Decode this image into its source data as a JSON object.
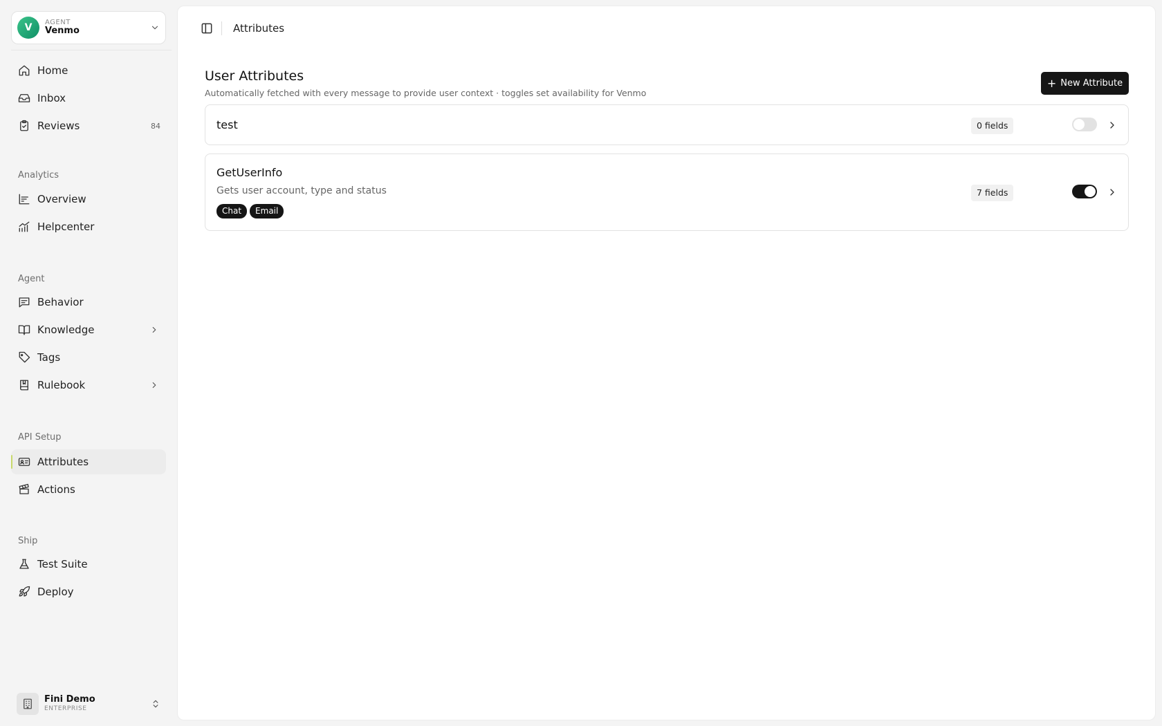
{
  "agent_switcher": {
    "avatar_letter": "V",
    "caption": "AGENT",
    "name": "Venmo"
  },
  "nav": {
    "home": "Home",
    "inbox": "Inbox",
    "reviews": {
      "label": "Reviews",
      "badge": "84"
    },
    "analytics_section": "Analytics",
    "overview": "Overview",
    "helpcenter": "Helpcenter",
    "agent_section": "Agent",
    "behavior": "Behavior",
    "knowledge": "Knowledge",
    "tags": "Tags",
    "rulebook": "Rulebook",
    "api_section": "API Setup",
    "attributes": "Attributes",
    "actions": "Actions",
    "ship_section": "Ship",
    "test_suite": "Test Suite",
    "deploy": "Deploy"
  },
  "org": {
    "name": "Fini Demo",
    "plan": "ENTERPRISE"
  },
  "header": {
    "breadcrumb": "Attributes"
  },
  "page": {
    "title": "User Attributes",
    "subtitle": "Automatically fetched with every message to provide user context · toggles set availability for Venmo",
    "new_button": "New Attribute"
  },
  "attributes": [
    {
      "name": "test",
      "description": "",
      "tags": [],
      "fields": "0 fields",
      "enabled": false
    },
    {
      "name": "GetUserInfo",
      "description": "Gets user account, type and status",
      "tags": [
        "Chat",
        "Email"
      ],
      "fields": "7 fields",
      "enabled": true
    }
  ],
  "colors": {
    "accent": "#161616",
    "active_indicator": "#c8d96b",
    "avatar": "#1fa877"
  }
}
